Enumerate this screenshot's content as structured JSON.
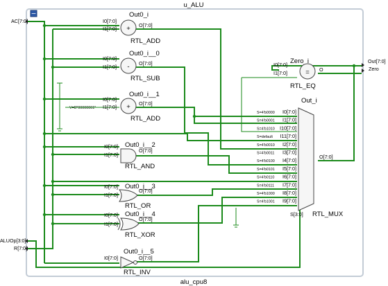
{
  "module": {
    "title": "u_ALU",
    "footer": "alu_cpu8",
    "collapse_symbol": "−"
  },
  "ports": {
    "inputs": [
      "AC[7:0]",
      "ALUOp[3:0]",
      "R[7:0]"
    ],
    "outputs": [
      "Out[7:0]",
      "Zero"
    ]
  },
  "cells": [
    {
      "instance": "Out0_i",
      "type": "RTL_ADD",
      "symbol": "+",
      "inputs": [
        "I0[7:0]",
        "I1[7:0]"
      ],
      "output": "O[7:0]"
    },
    {
      "instance": "Out0_i__0",
      "type": "RTL_SUB",
      "symbol": "-",
      "inputs": [
        "I0[7:0]",
        "I1[7:0]"
      ],
      "output": "O[7:0]"
    },
    {
      "instance": "Out0_i__1",
      "type": "RTL_ADD",
      "symbol": "+",
      "inputs": [
        "I0[7:0]",
        "I1[7:0]"
      ],
      "output": "O[7:0]"
    },
    {
      "instance": "Out0_i__2",
      "type": "RTL_AND",
      "inputs": [
        "I0[7:0]",
        "I1[7:0]"
      ],
      "output": "O[7:0]"
    },
    {
      "instance": "Out0_i__3",
      "type": "RTL_OR",
      "inputs": [
        "I0[7:0]",
        "I1[7:0]"
      ],
      "output": "O[7:0]"
    },
    {
      "instance": "Out0_i__4",
      "type": "RTL_XOR",
      "inputs": [
        "I0[7:0]",
        "I1[7:0]"
      ],
      "output": "O[7:0]"
    },
    {
      "instance": "Out0_i__5",
      "type": "RTL_INV",
      "inputs": [
        "I0[7:0]"
      ],
      "output": "O[7:0]"
    },
    {
      "instance": "Zero_i",
      "type": "RTL_EQ",
      "symbol": "=",
      "inputs": [
        "I0[7:0]",
        "I1[7:0]"
      ],
      "output": "O"
    }
  ],
  "constant": "V=B\"00000001\"",
  "mux": {
    "instance": "Out_i",
    "type": "RTL_MUX",
    "select": "S[3:0]",
    "output": "O[7:0]",
    "inputs": [
      {
        "sel": "S=4'b0000",
        "pin": "I0[7:0]"
      },
      {
        "sel": "S=4'b0001",
        "pin": "I1[7:0]"
      },
      {
        "sel": "S=4'b1010",
        "pin": "I10[7:0]"
      },
      {
        "sel": "S=default",
        "pin": "I11[7:0]"
      },
      {
        "sel": "S=4'b0010",
        "pin": "I2[7:0]"
      },
      {
        "sel": "S=4'b0011",
        "pin": "I3[7:0]"
      },
      {
        "sel": "S=4'b0100",
        "pin": "I4[7:0]"
      },
      {
        "sel": "S=4'b0101",
        "pin": "I5[7:0]"
      },
      {
        "sel": "S=4'b0110",
        "pin": "I6[7:0]"
      },
      {
        "sel": "S=4'b0111",
        "pin": "I7[7:0]"
      },
      {
        "sel": "S=4'b1000",
        "pin": "I8[7:0]"
      },
      {
        "sel": "S=4'b1001",
        "pin": "I9[7:0]"
      }
    ]
  }
}
